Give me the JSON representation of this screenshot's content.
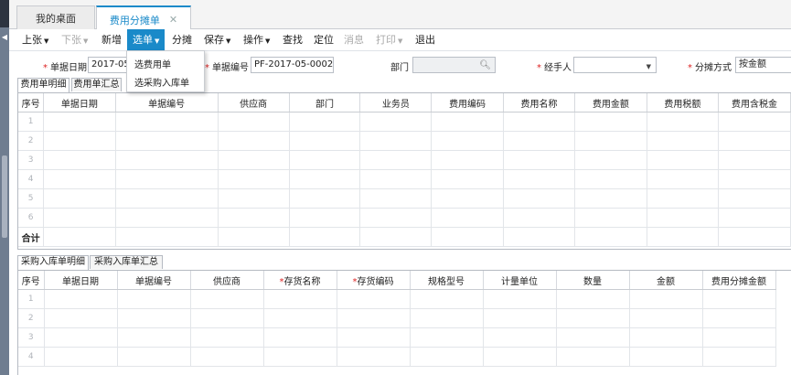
{
  "tabs": [
    {
      "label": "我的桌面",
      "active": false
    },
    {
      "label": "费用分摊单",
      "active": true
    }
  ],
  "toolbar": {
    "items": [
      {
        "label": "上张",
        "caret": true,
        "disabled": false
      },
      {
        "label": "下张",
        "caret": true,
        "disabled": true
      },
      {
        "label": "新增",
        "caret": false,
        "disabled": false
      },
      {
        "label": "选单",
        "caret": true,
        "disabled": false
      },
      {
        "label": "分摊",
        "caret": false,
        "disabled": false
      },
      {
        "label": "保存",
        "caret": true,
        "disabled": false
      },
      {
        "label": "操作",
        "caret": true,
        "disabled": false
      },
      {
        "label": "查找",
        "caret": false,
        "disabled": false
      },
      {
        "label": "定位",
        "caret": false,
        "disabled": false
      },
      {
        "label": "消息",
        "caret": false,
        "disabled": true
      },
      {
        "label": "打印",
        "caret": true,
        "disabled": true
      },
      {
        "label": "退出",
        "caret": false,
        "disabled": false
      }
    ]
  },
  "dropdown": {
    "options": [
      "选费用单",
      "选采购入库单"
    ]
  },
  "form": {
    "date_label": "单据日期",
    "date_value": "2017-05-",
    "number_label": "单据编号",
    "number_value": "PF-2017-05-0002",
    "dept_label": "部门",
    "dept_value": "",
    "handler_label": "经手人",
    "handler_value": "",
    "method_label": "分摊方式",
    "method_value": "按金额"
  },
  "expense": {
    "tabs": [
      "费用单明细",
      "费用单汇总"
    ],
    "columns": [
      "序号",
      "单据日期",
      "单据编号",
      "供应商",
      "部门",
      "业务员",
      "费用编码",
      "费用名称",
      "费用金额",
      "费用税额",
      "费用含税金"
    ],
    "rows": [
      "1",
      "2",
      "3",
      "4",
      "5",
      "6"
    ],
    "total_label": "合计"
  },
  "purchase": {
    "tabs": [
      "采购入库单明细",
      "采购入库单汇总"
    ],
    "columns": [
      "序号",
      "单据日期",
      "单据编号",
      "供应商",
      "存货名称",
      "存货编码",
      "规格型号",
      "计量单位",
      "数量",
      "金额",
      "费用分摊金额"
    ],
    "required": [
      false,
      false,
      false,
      false,
      true,
      true,
      false,
      false,
      false,
      false,
      false
    ],
    "rows": [
      "1",
      "2",
      "3",
      "4"
    ]
  },
  "colors": {
    "accent": "#1a8ac9",
    "required": "#dd2222"
  }
}
